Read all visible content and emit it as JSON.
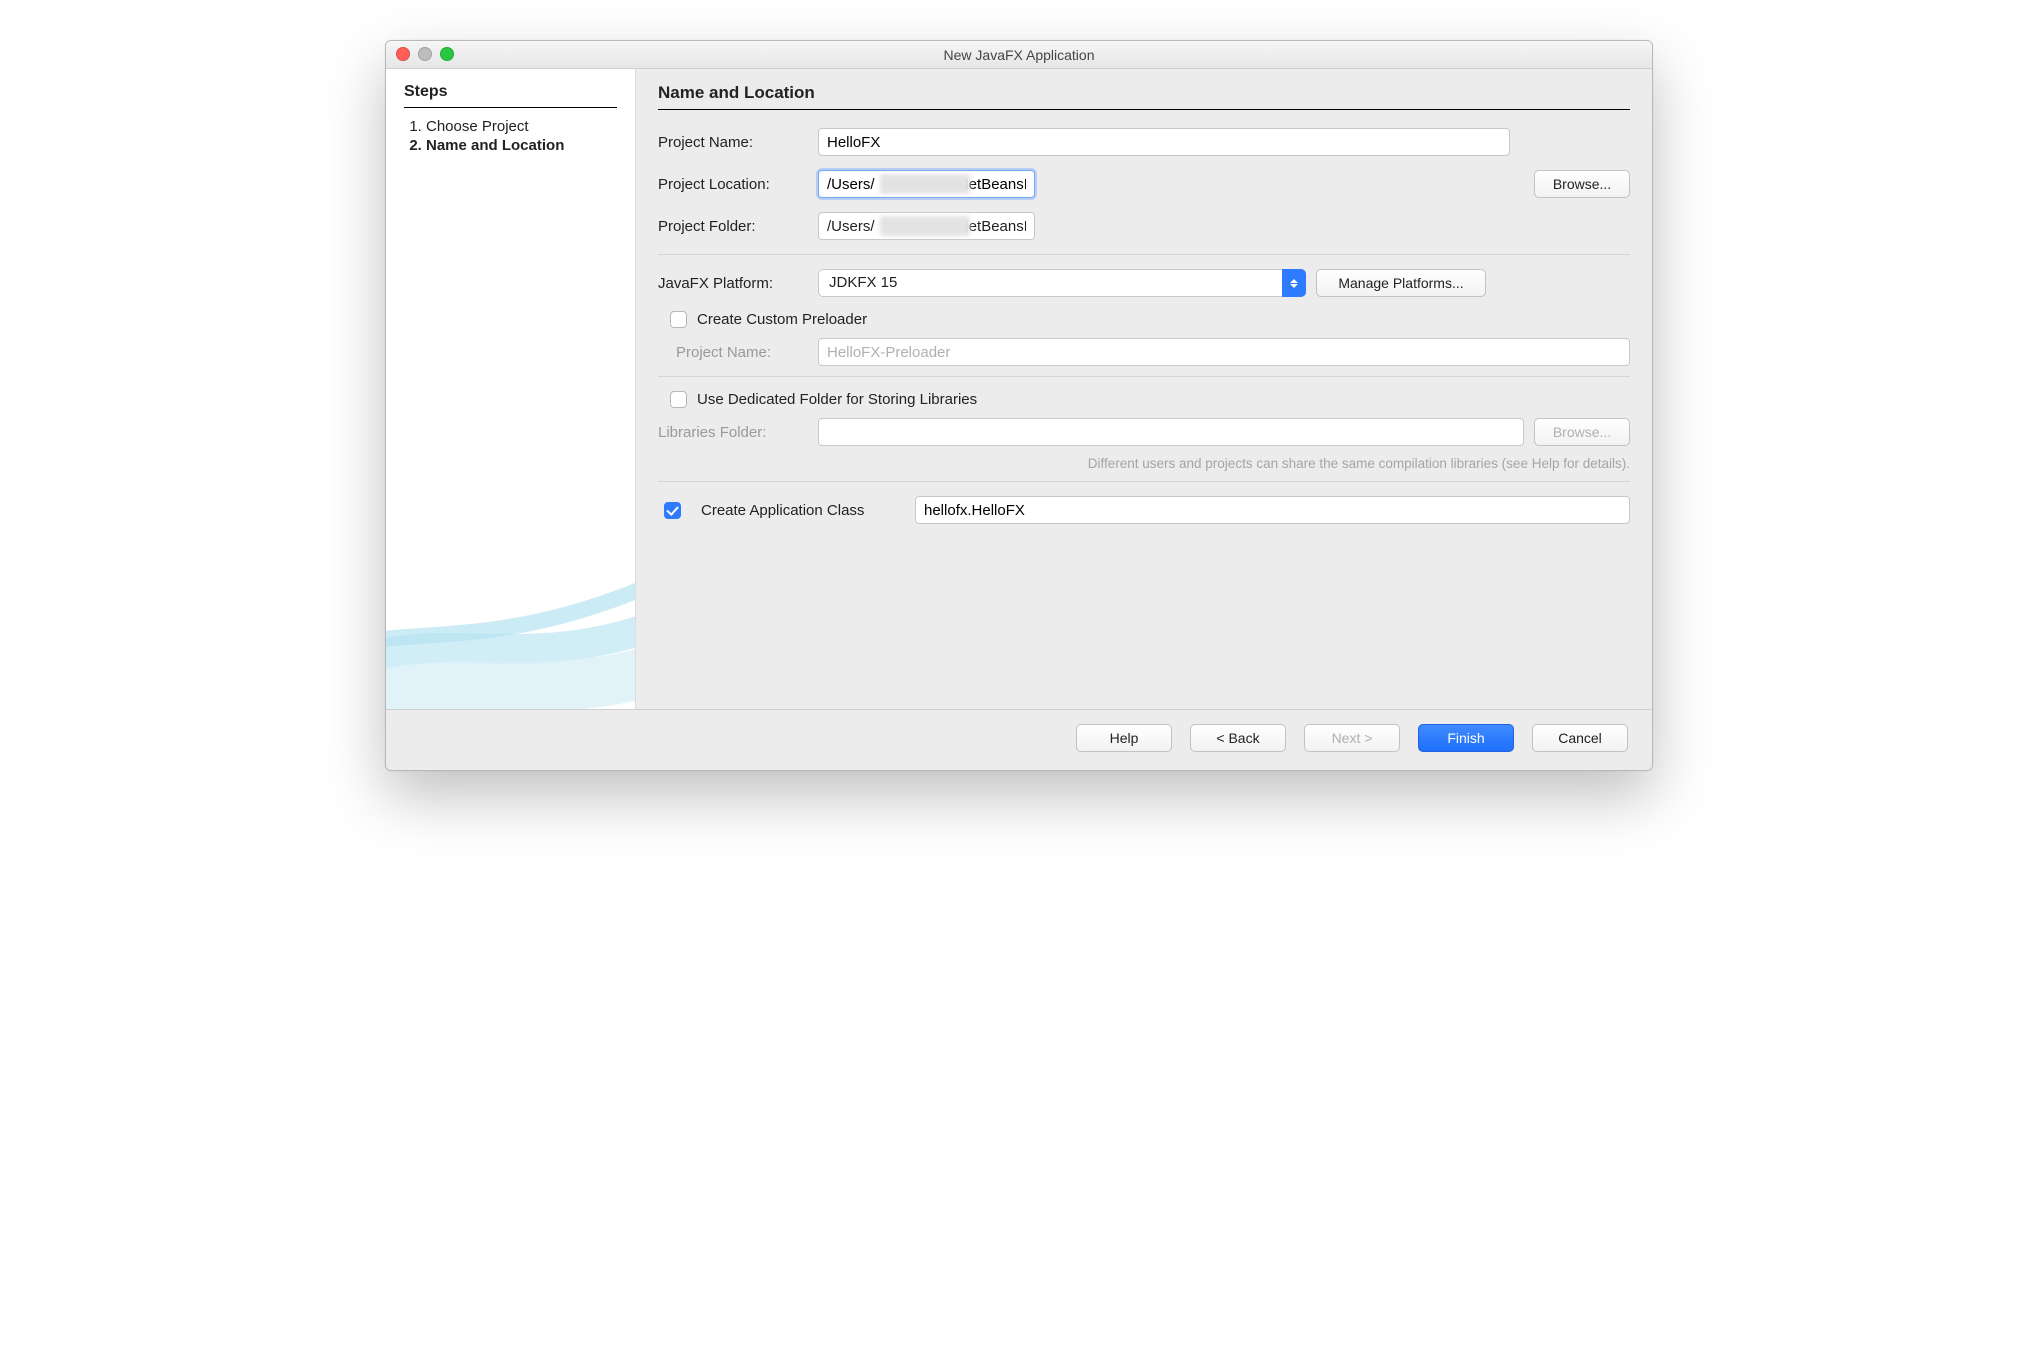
{
  "window": {
    "title": "New JavaFX Application"
  },
  "sidebar": {
    "heading": "Steps",
    "steps": [
      "Choose Project",
      "Name and Location"
    ],
    "current_index": 1
  },
  "main": {
    "heading": "Name and Location",
    "project_name_label": "Project Name:",
    "project_name_value": "HelloFX",
    "project_location_label": "Project Location:",
    "project_location_value": "/Users/                   /NetBeansProjects/Samples",
    "browse_label": "Browse...",
    "project_folder_label": "Project Folder:",
    "project_folder_value": "/Users/                   /NetBeansProjects/Samples/HelloFX",
    "platform_label": "JavaFX Platform:",
    "platform_value": "JDKFX 15",
    "manage_platforms_label": "Manage Platforms...",
    "preloader_checkbox_label": "Create Custom Preloader",
    "preloader_checked": false,
    "preloader_name_label": "Project Name:",
    "preloader_name_value": "HelloFX-Preloader",
    "dedicated_folder_label": "Use Dedicated Folder for Storing Libraries",
    "dedicated_folder_checked": false,
    "libraries_folder_label": "Libraries Folder:",
    "libraries_folder_value": "",
    "libraries_browse_label": "Browse...",
    "hint": "Different users and projects can share the same compilation libraries (see Help for details).",
    "app_class_checked": true,
    "app_class_label": "Create Application Class",
    "app_class_value": "hellofx.HelloFX"
  },
  "footer": {
    "help": "Help",
    "back": "< Back",
    "next": "Next >",
    "finish": "Finish",
    "cancel": "Cancel"
  }
}
